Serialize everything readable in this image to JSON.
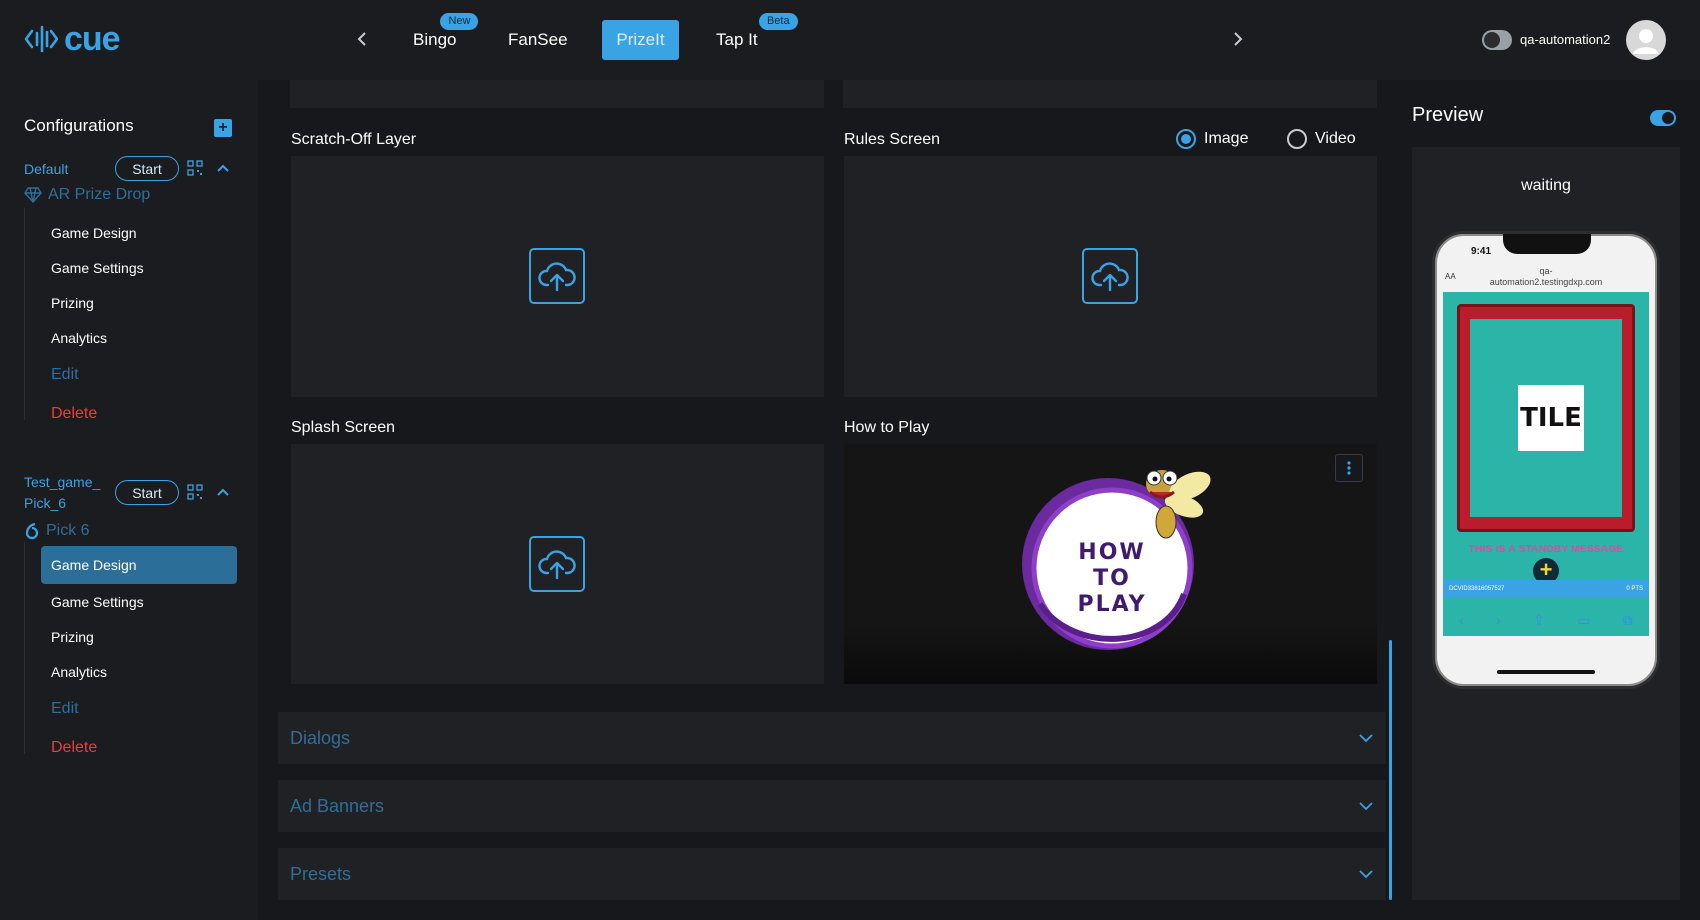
{
  "app": {
    "logo_text": "cue"
  },
  "nav": {
    "tabs": [
      {
        "label": "Bingo",
        "badge": "New"
      },
      {
        "label": "FanSee",
        "badge": ""
      },
      {
        "label": "PrizeIt",
        "badge": ""
      },
      {
        "label": "Tap It",
        "badge": "Beta"
      }
    ],
    "active_tab": "PrizeIt",
    "user_name": "qa-automation2"
  },
  "sidebar": {
    "title": "Configurations",
    "configs": [
      {
        "name": "Default",
        "start_label": "Start",
        "game_type": "AR Prize Drop",
        "items": [
          "Game Design",
          "Game Settings",
          "Prizing",
          "Analytics",
          "Edit",
          "Delete"
        ]
      },
      {
        "name": "Test_game_\nPick_6",
        "name_line1": "Test_game_",
        "name_line2": "Pick_6",
        "start_label": "Start",
        "game_type": "Pick 6",
        "items": [
          "Game Design",
          "Game Settings",
          "Prizing",
          "Analytics",
          "Edit",
          "Delete"
        ],
        "active_item": "Game Design"
      }
    ]
  },
  "main": {
    "cards": {
      "scratch_off": "Scratch-Off Layer",
      "rules": "Rules Screen",
      "splash": "Splash Screen",
      "how_to_play": "How to Play"
    },
    "media_type": {
      "options": [
        "Image",
        "Video"
      ],
      "selected": "Image"
    },
    "how_to_play_image_text": "HOW TO PLAY",
    "accordions": [
      "Dialogs",
      "Ad Banners",
      "Presets"
    ]
  },
  "preview": {
    "title": "Preview",
    "enabled": true,
    "status": "waiting",
    "phone": {
      "time": "9:41",
      "url_line1": "qa-",
      "url_line2": "automation2.testingdxp.com",
      "text_size": "AA",
      "tile_text": "TILE",
      "message": "THIS IS A STANDBY MESSAGE",
      "footer_id": "DCVID33816057527",
      "footer_pts": "0 PTS"
    }
  },
  "colors": {
    "accent": "#3aa3e3",
    "danger": "#ef3b3b",
    "muted_link": "#2f6e9a"
  }
}
